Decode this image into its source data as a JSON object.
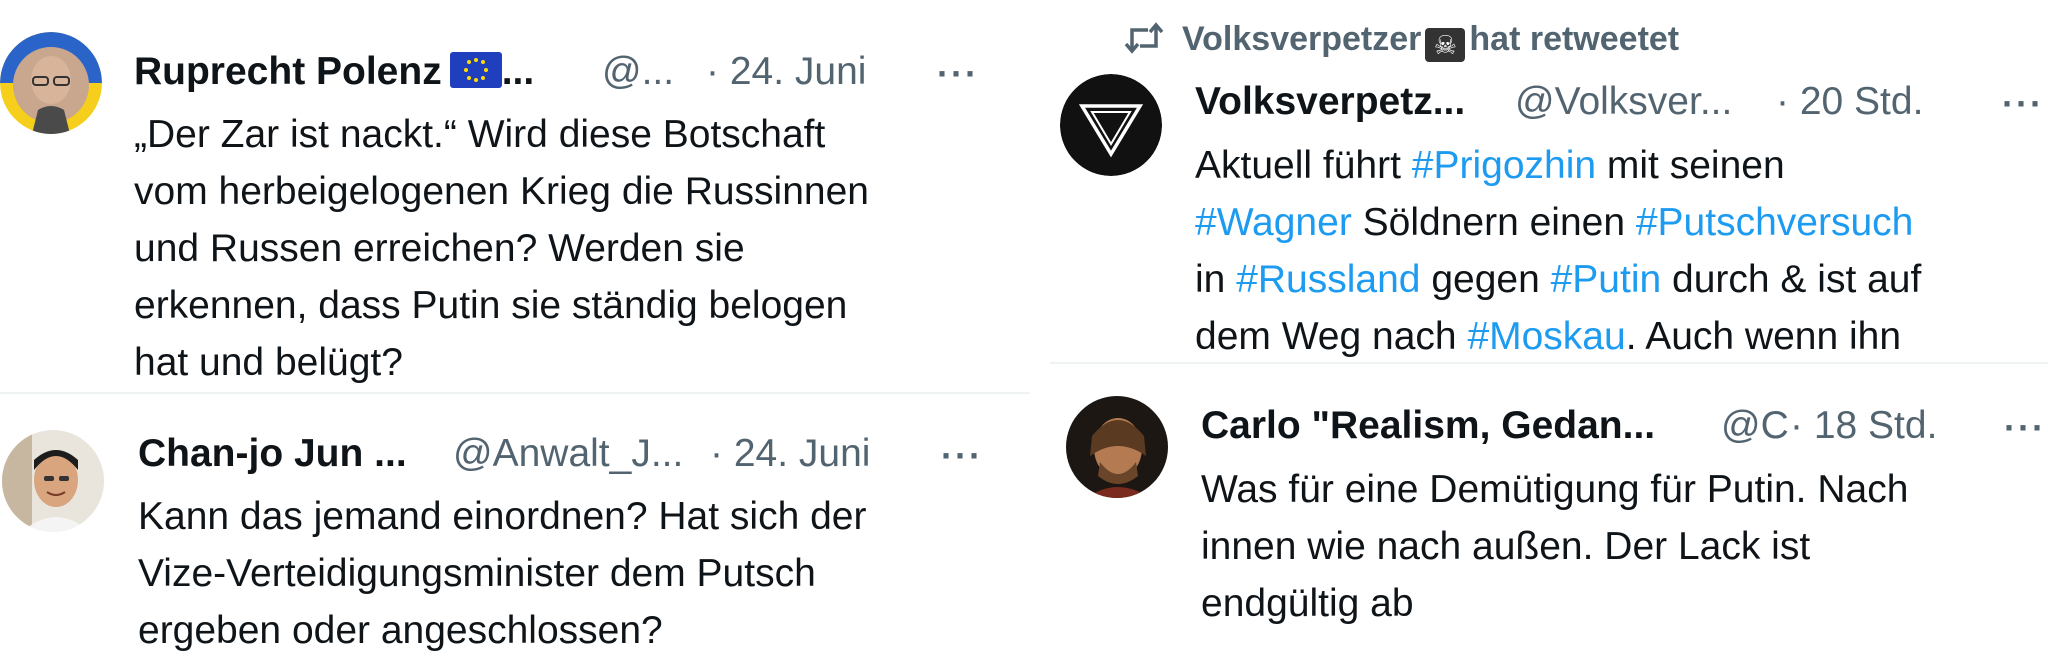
{
  "tweets": [
    {
      "name": "Ruprecht Polenz",
      "name_suffix": "...",
      "handle": "@...",
      "time": "· 24. Juni",
      "more": "···",
      "lines": [
        "„Der Zar ist nackt.“ Wird diese Botschaft",
        "vom herbeigelogenen Krieg die Russinnen",
        "und Russen erreichen? Werden sie",
        "erkennen, dass Putin sie ständig belogen",
        "hat und belügt?"
      ]
    },
    {
      "name": "Chan-jo Jun ...",
      "handle": "@Anwalt_J...",
      "time": "· 24. Juni",
      "more": "···",
      "lines": [
        "Kann das jemand einordnen? Hat sich der",
        "Vize-Verteidigungsminister dem Putsch",
        "ergeben oder angeschlossen?"
      ]
    },
    {
      "retweet": {
        "account": "Volksverpetzer",
        "suffix": "hat retweetet"
      },
      "name": "Volksverpetz...",
      "handle": "@Volksver...",
      "time": "· 20 Std.",
      "more": "···",
      "line1": {
        "t1": "Aktuell führt ",
        "h1": "#Prigozhin",
        "t2": " mit seinen"
      },
      "line2": {
        "h1": "#Wagner",
        "t1": " Söldnern einen ",
        "h2": "#Putschversuch"
      },
      "line3": {
        "t1": "in ",
        "h1": "#Russland",
        "t2": " gegen ",
        "h2": "#Putin",
        "t3": " durch & ist auf"
      },
      "line4": {
        "t1": "dem Weg nach ",
        "h1": "#Moskau",
        "t2": ". Auch wenn ihn"
      }
    },
    {
      "name": "Carlo \"Realism, Gedan...",
      "handle": "@C",
      "time": "· 18 Std.",
      "more": "···",
      "lines": [
        "Was für eine Demütigung für Putin. Nach",
        "innen wie nach außen. Der Lack ist",
        "endgültig ab"
      ]
    }
  ],
  "colors": {
    "text": "#0f1419",
    "secondary": "#536471",
    "hashtag": "#1d9bf0",
    "divider": "#eff3f4"
  },
  "icons": {
    "retweet": "retweet-icon",
    "eu_flag": "eu-flag-icon",
    "skull": "skull-crossbones-icon",
    "more": "more-options-icon"
  }
}
